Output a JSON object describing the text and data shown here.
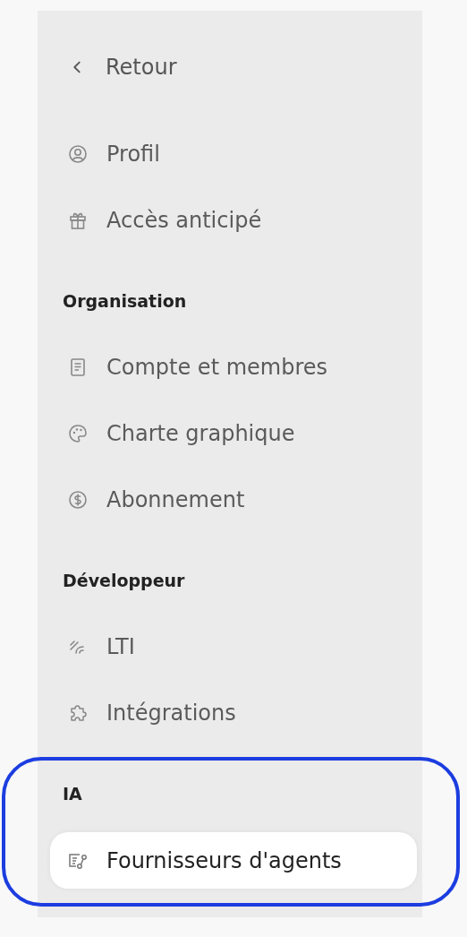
{
  "back": {
    "label": "Retour"
  },
  "groups": [
    {
      "items": [
        {
          "kind": "profile",
          "label": "Profil",
          "selected": false
        },
        {
          "kind": "gift",
          "label": "Accès anticipé",
          "selected": false
        }
      ]
    },
    {
      "heading": "Organisation",
      "items": [
        {
          "kind": "document",
          "label": "Compte et membres",
          "selected": false
        },
        {
          "kind": "palette",
          "label": "Charte graphique",
          "selected": false
        },
        {
          "kind": "dollar",
          "label": "Abonnement",
          "selected": false
        }
      ]
    },
    {
      "heading": "Développeur",
      "items": [
        {
          "kind": "signal",
          "label": "LTI",
          "selected": false
        },
        {
          "kind": "puzzle",
          "label": "Intégrations",
          "selected": false
        }
      ]
    },
    {
      "heading": "IA",
      "highlighted": true,
      "items": [
        {
          "kind": "agents",
          "label": "Fournisseurs d'agents",
          "selected": true
        }
      ]
    }
  ]
}
